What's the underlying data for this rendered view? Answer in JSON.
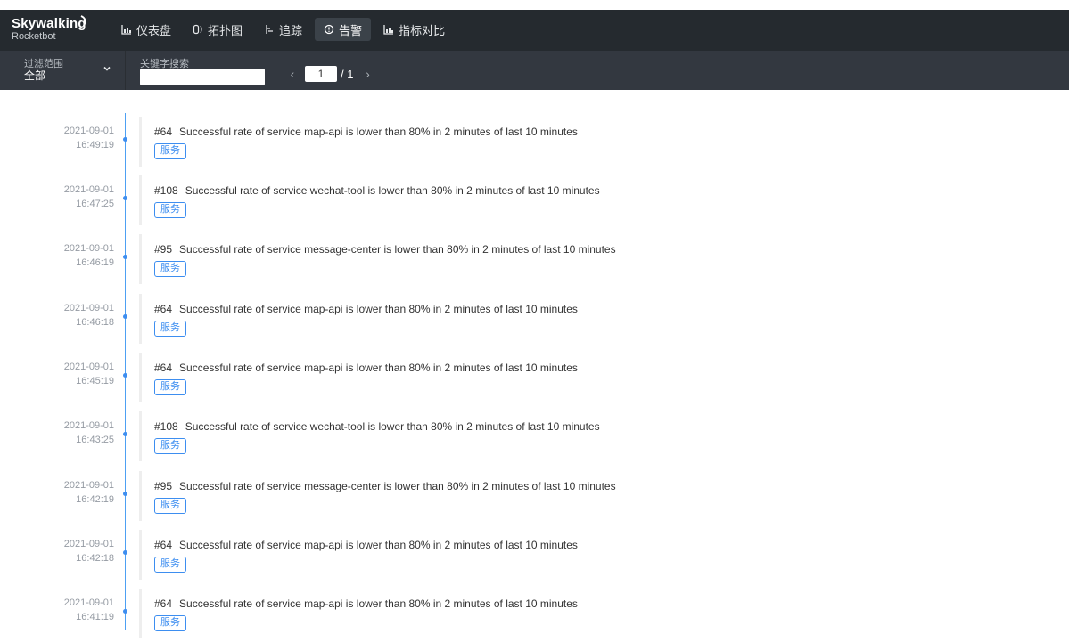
{
  "app": {
    "logo_name": "Skywalking",
    "logo_sub": "Rocketbot"
  },
  "nav": [
    {
      "label": "仪表盘",
      "icon": "bar-chart-icon",
      "active": false
    },
    {
      "label": "拓扑图",
      "icon": "topology-icon",
      "active": false
    },
    {
      "label": "追踪",
      "icon": "trace-icon",
      "active": false
    },
    {
      "label": "告警",
      "icon": "alarm-icon",
      "active": true
    },
    {
      "label": "指标对比",
      "icon": "bar-chart-icon",
      "active": false
    }
  ],
  "toolbar": {
    "filter_label": "过滤范围",
    "filter_value": "全部",
    "keyword_label": "关键字搜索",
    "keyword_value": "",
    "page_current": "1",
    "page_total": "/ 1"
  },
  "alarms": [
    {
      "date": "2021-09-01",
      "time": "16:49:19",
      "id": "#64",
      "message": "Successful rate of service map-api is lower than 80% in 2 minutes of last 10 minutes",
      "tag": "服务"
    },
    {
      "date": "2021-09-01",
      "time": "16:47:25",
      "id": "#108",
      "message": "Successful rate of service wechat-tool is lower than 80% in 2 minutes of last 10 minutes",
      "tag": "服务"
    },
    {
      "date": "2021-09-01",
      "time": "16:46:19",
      "id": "#95",
      "message": "Successful rate of service message-center is lower than 80% in 2 minutes of last 10 minutes",
      "tag": "服务"
    },
    {
      "date": "2021-09-01",
      "time": "16:46:18",
      "id": "#64",
      "message": "Successful rate of service map-api is lower than 80% in 2 minutes of last 10 minutes",
      "tag": "服务"
    },
    {
      "date": "2021-09-01",
      "time": "16:45:19",
      "id": "#64",
      "message": "Successful rate of service map-api is lower than 80% in 2 minutes of last 10 minutes",
      "tag": "服务"
    },
    {
      "date": "2021-09-01",
      "time": "16:43:25",
      "id": "#108",
      "message": "Successful rate of service wechat-tool is lower than 80% in 2 minutes of last 10 minutes",
      "tag": "服务"
    },
    {
      "date": "2021-09-01",
      "time": "16:42:19",
      "id": "#95",
      "message": "Successful rate of service message-center is lower than 80% in 2 minutes of last 10 minutes",
      "tag": "服务"
    },
    {
      "date": "2021-09-01",
      "time": "16:42:18",
      "id": "#64",
      "message": "Successful rate of service map-api is lower than 80% in 2 minutes of last 10 minutes",
      "tag": "服务"
    },
    {
      "date": "2021-09-01",
      "time": "16:41:19",
      "id": "#64",
      "message": "Successful rate of service map-api is lower than 80% in 2 minutes of last 10 minutes",
      "tag": "服务"
    }
  ]
}
